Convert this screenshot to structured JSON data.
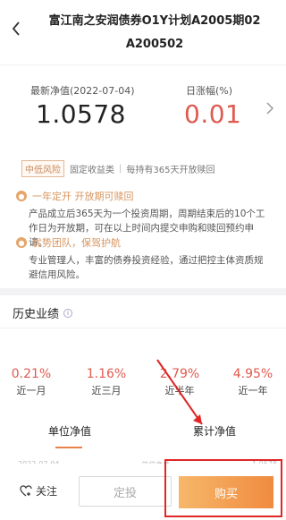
{
  "header": {
    "title": "富江南之安润债券O1Y计划A2005期02 A200502"
  },
  "nav": {
    "nav_label": "最新净值(2022-07-04)",
    "nav_value": "1.0578",
    "change_label": "日涨幅(%)",
    "change_value": "0.01"
  },
  "tags": {
    "risk": "中低风险",
    "type": "固定收益类",
    "holding": "每持有365天开放赎回"
  },
  "features": [
    {
      "title": "一年定开 开放期可赎回",
      "desc": "产品成立后365天为一个投资周期，周期结束后的10个工作日为开放期，可在以上时间内提交申购和赎回预约申请。"
    },
    {
      "title": "优势团队，保驾护航",
      "desc": "专业管理人，丰富的债券投资经验，通过把控主体资质规避信用风险。"
    }
  ],
  "performance": {
    "title": "历史业绩",
    "returns": [
      {
        "value": "0.21%",
        "label": "近一月"
      },
      {
        "value": "1.16%",
        "label": "近三月"
      },
      {
        "value": "2.79%",
        "label": "近半年"
      },
      {
        "value": "4.95%",
        "label": "近一年"
      }
    ],
    "tabs": [
      "单位净值",
      "累计净值"
    ],
    "row_peek": [
      "2022-07-04",
      "单位净值",
      "1.0578"
    ]
  },
  "bottom": {
    "follow": "关注",
    "dingtou": "定投",
    "buy": "购买"
  },
  "colors": {
    "accent_orange": "#f08b40",
    "rise_red": "#e05a4f",
    "annotation_red": "#e02626"
  }
}
